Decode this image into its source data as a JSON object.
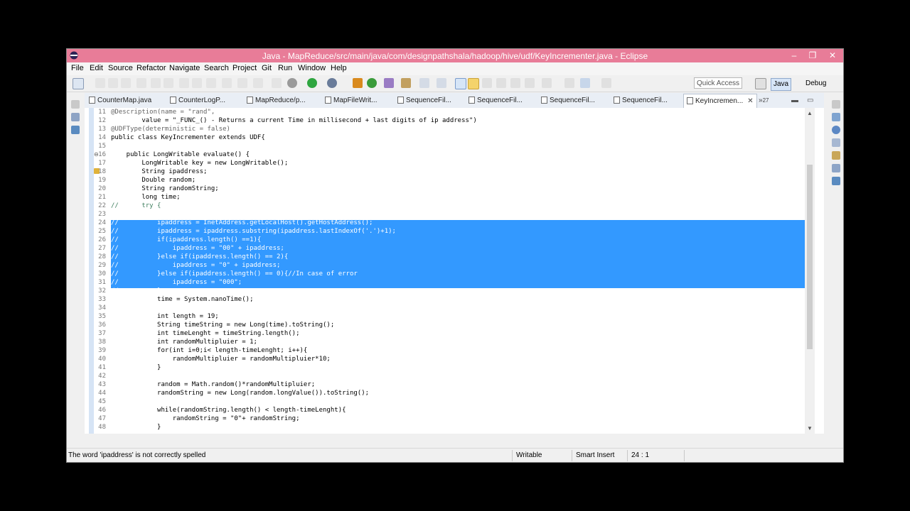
{
  "window": {
    "title": "Java - MapReduce/src/main/java/com/designpathshala/hadoop/hive/udf/KeyIncrementer.java - Eclipse",
    "controls": [
      "–",
      "❐",
      "✕"
    ]
  },
  "menu": [
    "File",
    "Edit",
    "Source",
    "Refactor",
    "Navigate",
    "Search",
    "Project",
    "Git",
    "Run",
    "Window",
    "Help"
  ],
  "toolbar": {
    "quick_access": "Quick Access",
    "perspectives": [
      "Java",
      "Debug"
    ]
  },
  "tabs": [
    {
      "label": "CounterMap.java"
    },
    {
      "label": "CounterLogP..."
    },
    {
      "label": "MapReduce/p..."
    },
    {
      "label": "MapFileWrit..."
    },
    {
      "label": "SequenceFil..."
    },
    {
      "label": "SequenceFil..."
    },
    {
      "label": "SequenceFil..."
    },
    {
      "label": "SequenceFil..."
    },
    {
      "label": "KeyIncremen..."
    }
  ],
  "hidden_tabs": "27",
  "code": [
    {
      "n": "11",
      "t": "@Description(name = \"rand\","
    },
    {
      "n": "12",
      "t": "        value = \"_FUNC_() - Returns a current Time in millisecond + last digits of ip address\")"
    },
    {
      "n": "13",
      "t": "@UDFType(deterministic = false)"
    },
    {
      "n": "14",
      "t": "public class KeyIncrementer extends UDF{"
    },
    {
      "n": "15",
      "t": ""
    },
    {
      "n": "16",
      "t": "    public LongWritable evaluate() {"
    },
    {
      "n": "17",
      "t": "        LongWritable key = new LongWritable();"
    },
    {
      "n": "18",
      "t": "        String ipaddress;"
    },
    {
      "n": "19",
      "t": "        Double random;"
    },
    {
      "n": "20",
      "t": "        String randomString;"
    },
    {
      "n": "21",
      "t": "        long time;"
    },
    {
      "n": "22",
      "t": "//      try {"
    },
    {
      "n": "23",
      "t": ""
    },
    {
      "n": "24",
      "t": "//          ipaddress = InetAddress.getLocalHost().getHostAddress();"
    },
    {
      "n": "25",
      "t": "//          ipaddress = ipaddress.substring(ipaddress.lastIndexOf('.')+1);"
    },
    {
      "n": "26",
      "t": "//          if(ipaddress.length() ==1){"
    },
    {
      "n": "27",
      "t": "//              ipaddress = \"00\" + ipaddress;"
    },
    {
      "n": "28",
      "t": "//          }else if(ipaddress.length() == 2){"
    },
    {
      "n": "29",
      "t": "//              ipaddress = \"0\" + ipaddress;"
    },
    {
      "n": "30",
      "t": "//          }else if(ipaddress.length() == 0){//In case of error"
    },
    {
      "n": "31",
      "t": "//              ipaddress = \"000\";"
    },
    {
      "n": "32",
      "t": "//          }"
    },
    {
      "n": "33",
      "t": "            time = System.nanoTime();"
    },
    {
      "n": "34",
      "t": ""
    },
    {
      "n": "35",
      "t": "            int length = 19;"
    },
    {
      "n": "36",
      "t": "            String timeString = new Long(time).toString();"
    },
    {
      "n": "37",
      "t": "            int timeLenght = timeString.length();"
    },
    {
      "n": "38",
      "t": "            int randomMultipluier = 1;"
    },
    {
      "n": "39",
      "t": "            for(int i=0;i< length-timeLenght; i++){"
    },
    {
      "n": "40",
      "t": "                randomMultipluier = randomMultipluier*10;"
    },
    {
      "n": "41",
      "t": "            }"
    },
    {
      "n": "42",
      "t": ""
    },
    {
      "n": "43",
      "t": "            random = Math.random()*randomMultipluier;"
    },
    {
      "n": "44",
      "t": "            randomString = new Long(random.longValue()).toString();"
    },
    {
      "n": "45",
      "t": ""
    },
    {
      "n": "46",
      "t": "            while(randomString.length() < length-timeLenght){"
    },
    {
      "n": "47",
      "t": "                randomString = \"0\"+ randomString;"
    },
    {
      "n": "48",
      "t": "            }"
    }
  ],
  "status": {
    "message": "The word 'ipaddress' is not correctly spelled",
    "mode": "Writable",
    "insert": "Smart Insert",
    "position": "24 : 1"
  },
  "colors": {
    "title_bar": "#e87c98",
    "selection": "#3399ff",
    "keyword": "#7f0055",
    "string": "#2a00ff",
    "comment": "#3f7f5f"
  }
}
